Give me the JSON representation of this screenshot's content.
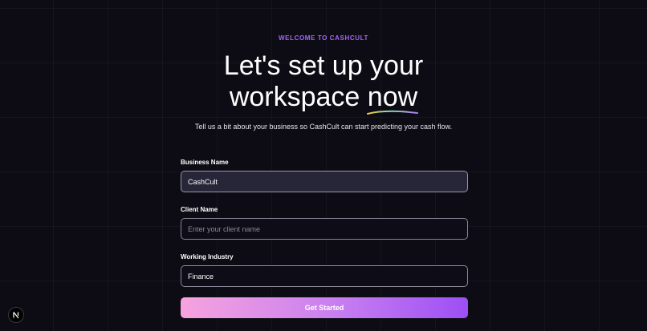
{
  "header": {
    "eyebrow": "WELCOME TO CASHCULT",
    "headline_line1": "Let's set up your",
    "headline_line2_prefix": "workspace ",
    "headline_accent": "now",
    "subtitle": "Tell us a bit about your business so CashCult can start predicting your cash flow."
  },
  "form": {
    "business_name": {
      "label": "Business Name",
      "value": "CashCult",
      "placeholder": ""
    },
    "client_name": {
      "label": "Client Name",
      "value": "",
      "placeholder": "Enter your client name"
    },
    "working_industry": {
      "label": "Working Industry",
      "value": "Finance",
      "placeholder": ""
    },
    "submit_label": "Get Started"
  },
  "badge": {
    "letter": "N",
    "icon": "nextjs-logo-icon"
  },
  "colors": {
    "background": "#0d0b14",
    "accent": "#a468f7",
    "button_gradient_start": "#f7a3de",
    "button_gradient_end": "#9d4ff5"
  }
}
